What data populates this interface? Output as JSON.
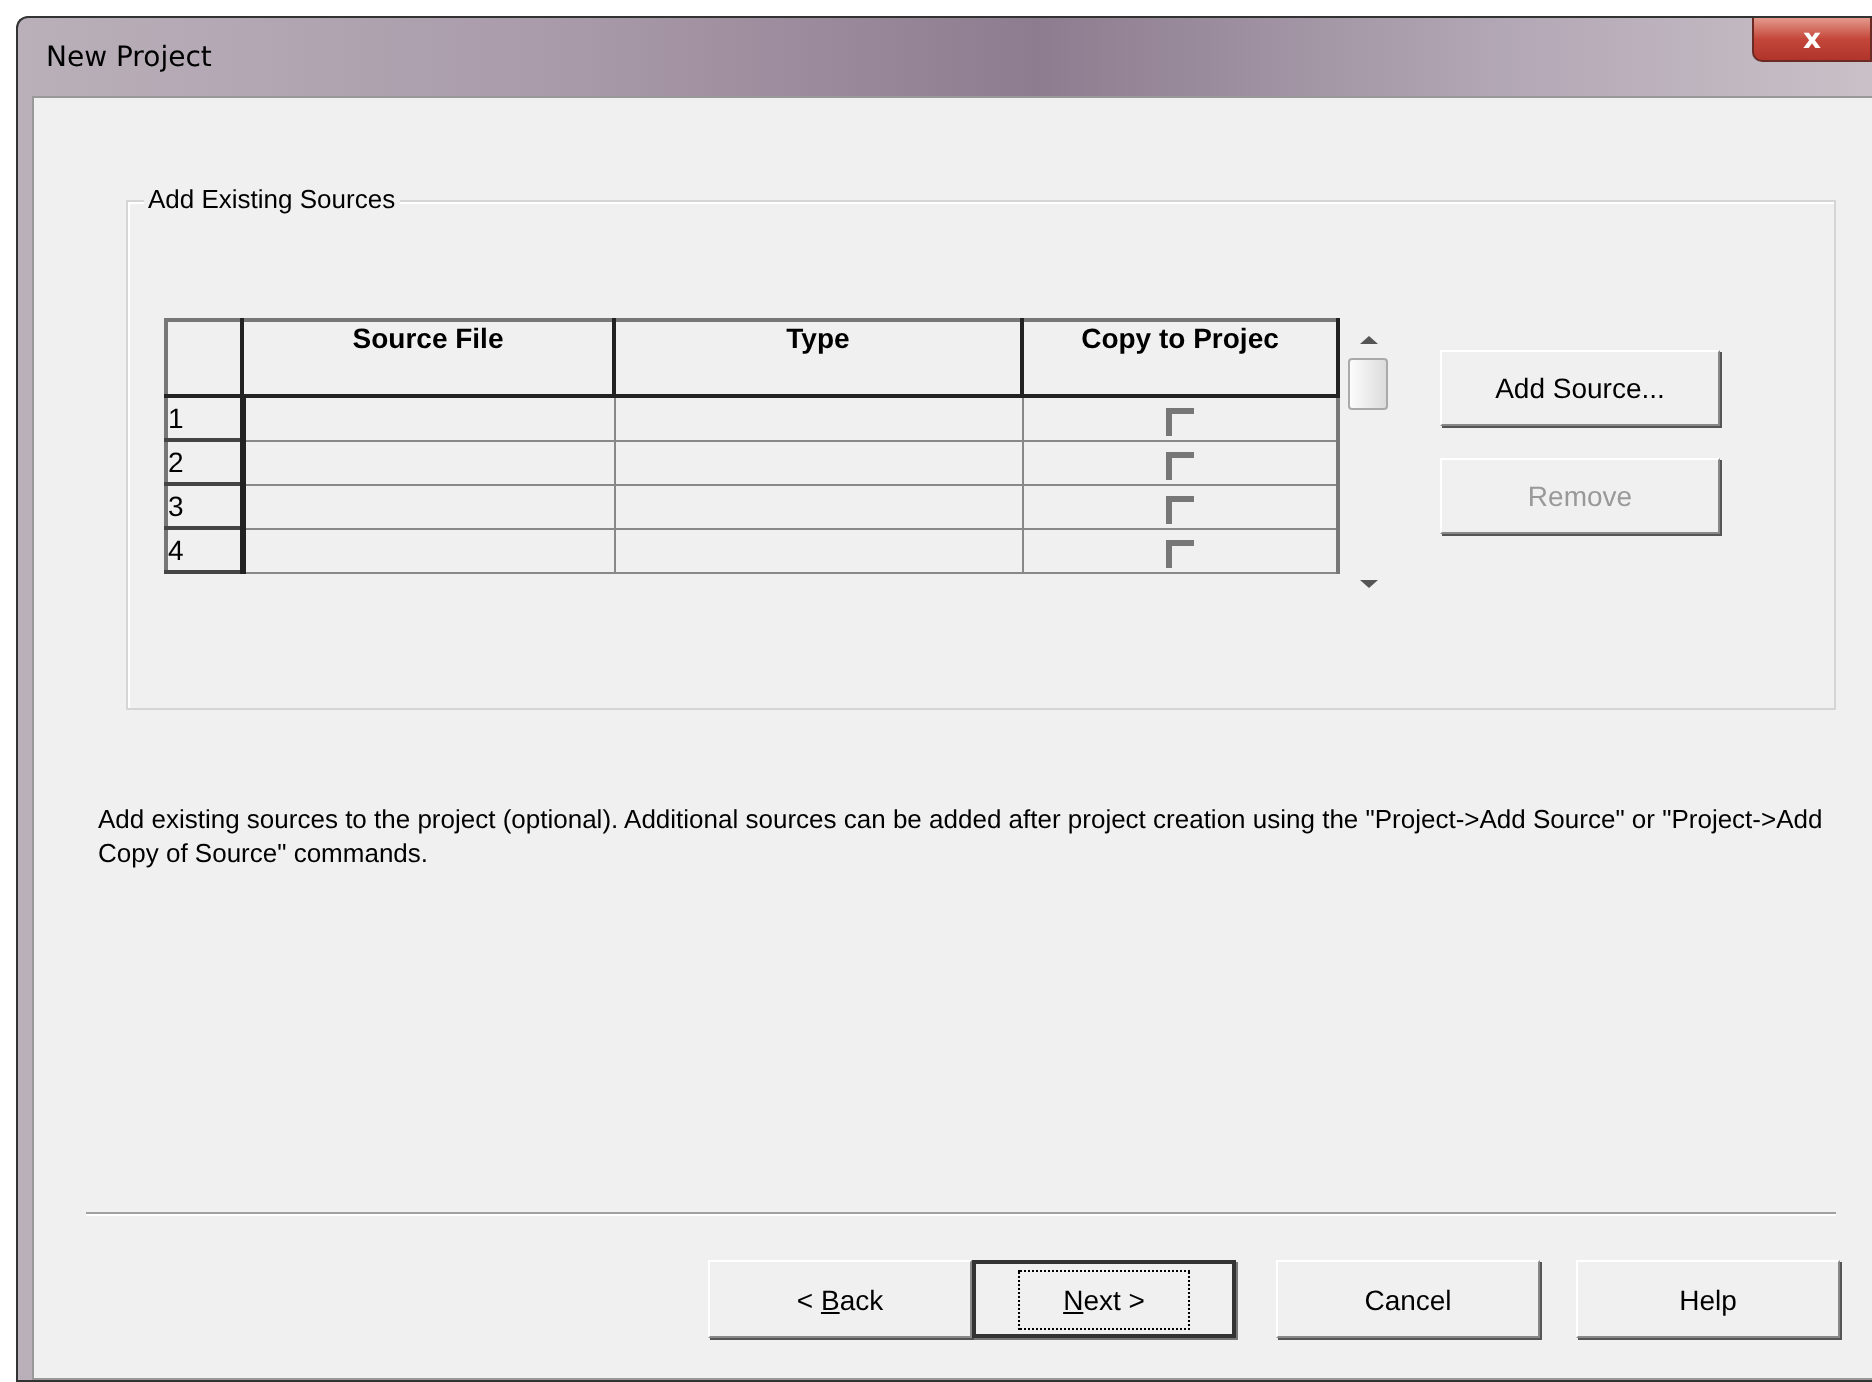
{
  "window": {
    "title": "New Project",
    "close": "x"
  },
  "group": {
    "title": "Add Existing Sources",
    "table": {
      "columns": [
        "Source File",
        "Type",
        "Copy to Projec"
      ],
      "rows": [
        {
          "number": "1",
          "checked": false
        },
        {
          "number": "2",
          "checked": false
        },
        {
          "number": "3",
          "checked": false
        },
        {
          "number": "4",
          "checked": false
        }
      ]
    },
    "buttons": [
      {
        "label": "Add Source...",
        "disabled": false
      },
      {
        "label": "Remove",
        "disabled": true
      }
    ]
  },
  "description": "Add existing sources to the project (optional). Additional sources can be added after project creation using the \"Project->Add Source\" or \"Project->Add Copy of Source\" commands.",
  "footer_buttons": [
    {
      "before": "< ",
      "key": "B",
      "after": "ack",
      "default": false
    },
    {
      "key": "N",
      "after": "ext >",
      "default": true
    },
    {
      "before": "Cancel",
      "default": false
    },
    {
      "before": "Help",
      "default": false
    }
  ]
}
